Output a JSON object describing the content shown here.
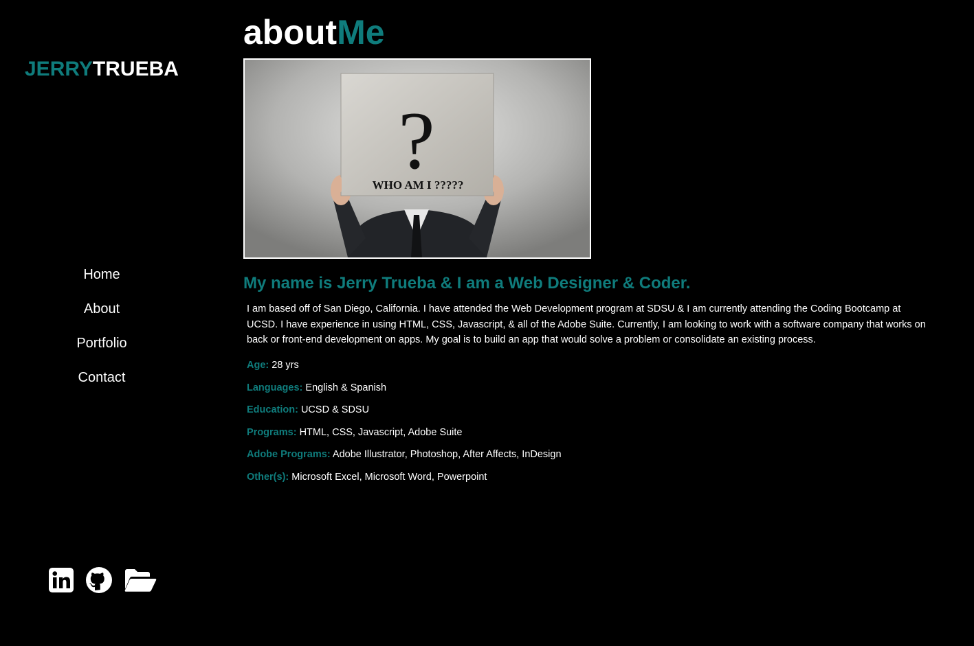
{
  "brand": {
    "first": "JERRY",
    "last": "TRUEBA"
  },
  "nav": {
    "items": [
      {
        "label": "Home"
      },
      {
        "label": "About"
      },
      {
        "label": "Portfolio"
      },
      {
        "label": "Contact"
      }
    ]
  },
  "social": {
    "icons": [
      "linkedin-icon",
      "github-icon",
      "folder-open-icon"
    ]
  },
  "main": {
    "title_part1": "about",
    "title_part2": "Me",
    "hero_sign_text": "WHO AM I ?????",
    "hero_sign_symbol": "?",
    "headline": "My name is Jerry Trueba & I am a Web Designer & Coder.",
    "bio": "I am based off of San Diego, California. I have attended the Web Development program at SDSU & I am currently attending the Coding Bootcamp at UCSD. I have experience in using HTML, CSS, Javascript, & all of the Adobe Suite. Currently, I am looking to work with a software company that works on back or front-end development on apps. My goal is to build an app that would solve a problem or consolidate an existing process.",
    "facts": [
      {
        "label": "Age:",
        "value": "28 yrs"
      },
      {
        "label": "Languages:",
        "value": "English & Spanish"
      },
      {
        "label": "Education:",
        "value": "UCSD & SDSU"
      },
      {
        "label": "Programs:",
        "value": "HTML, CSS, Javascript, Adobe Suite"
      },
      {
        "label": "Adobe Programs:",
        "value": "Adobe Illustrator, Photoshop, After Affects, InDesign"
      },
      {
        "label": "Other(s):",
        "value": "Microsoft Excel, Microsoft Word, Powerpoint"
      }
    ]
  },
  "colors": {
    "accent": "#0f7c7c",
    "background": "#000000",
    "text": "#ffffff"
  }
}
